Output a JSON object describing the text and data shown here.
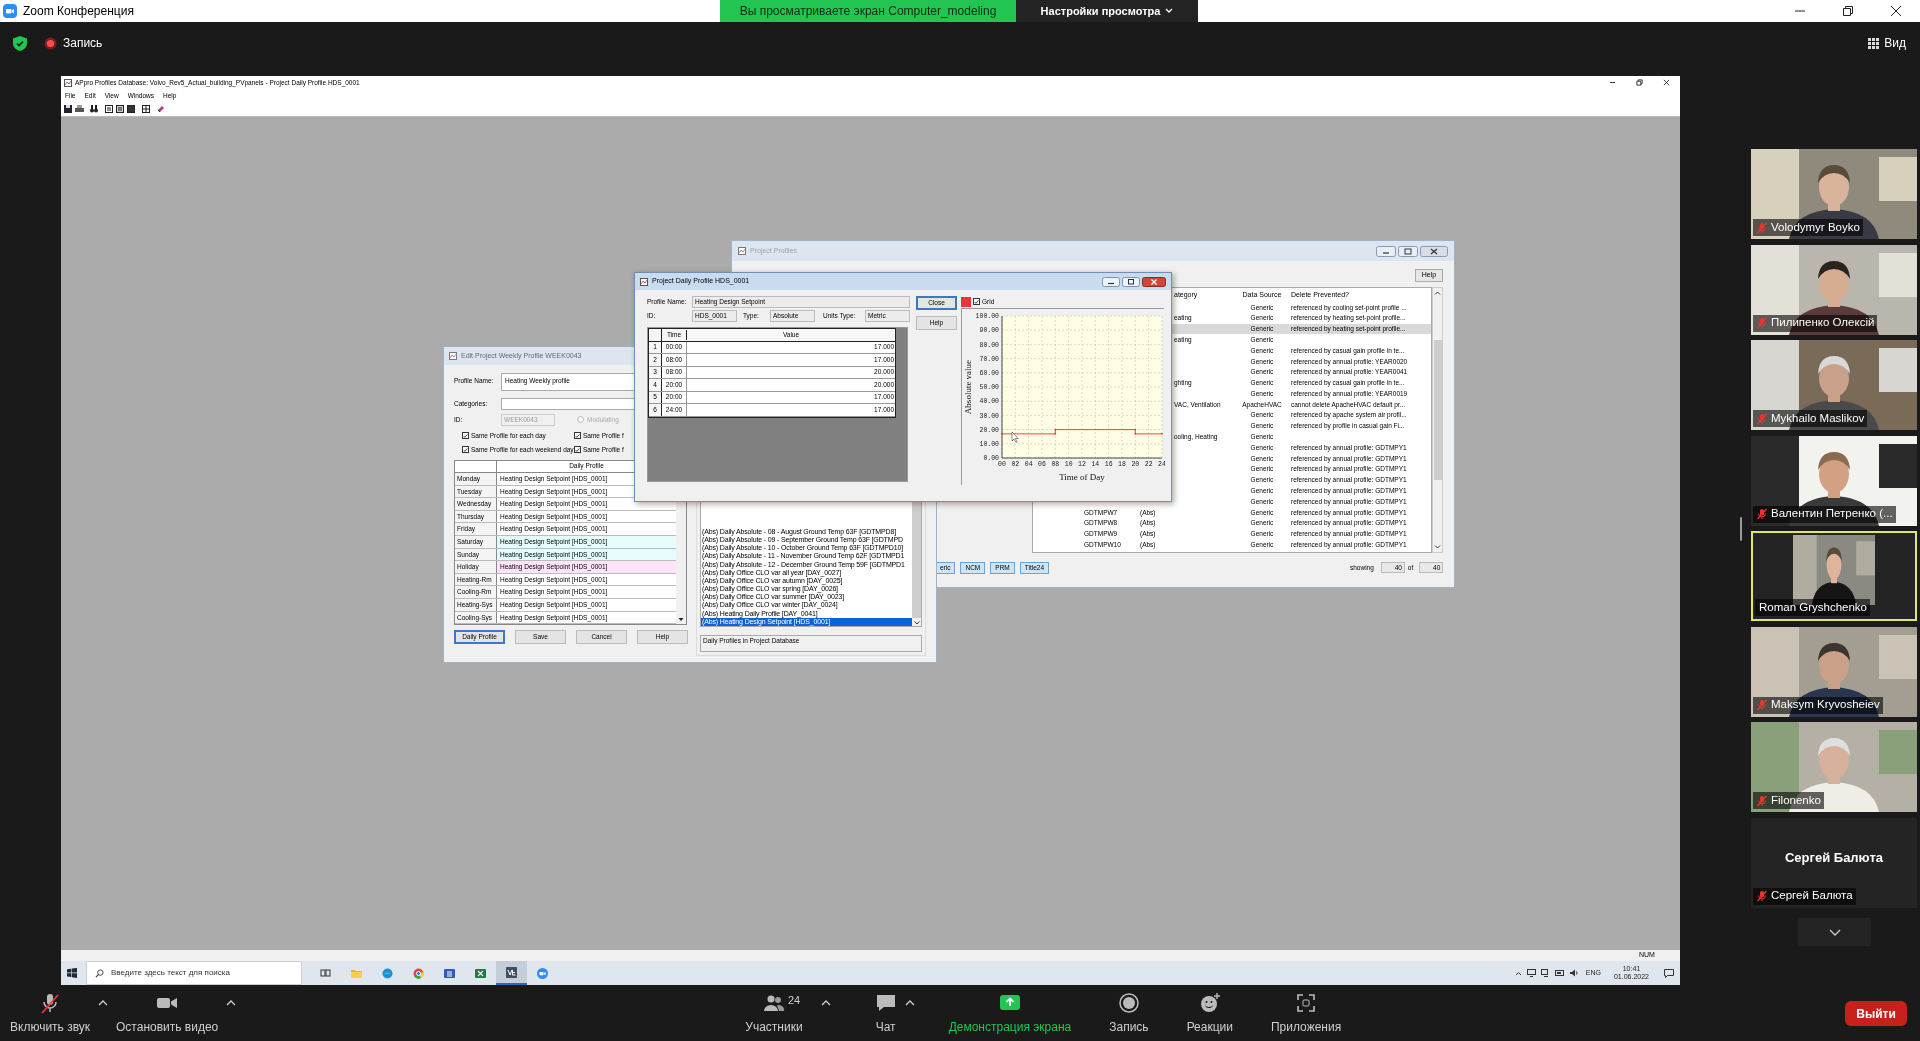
{
  "zoom": {
    "window_title": "Zoom Конференция",
    "banner": "Вы просматриваете экран Computer_modeling",
    "view_options": "Настройки просмотра",
    "recording": "Запись",
    "view": "Вид"
  },
  "app": {
    "title": "APpro Profiles Database: Volvo_Rev5_Actual_building_PVpanels - Project Daily Profile HDS_0001",
    "menu": [
      "File",
      "Edit",
      "View",
      "Windows",
      "Help"
    ],
    "status": "NUM"
  },
  "project_profiles": {
    "title": "Project Profiles",
    "help": "Help",
    "columns": [
      "ategory",
      "Data Source",
      "Delete Prevented?"
    ],
    "rows": [
      {
        "source": "Generic",
        "note": "referenced by cooling set-point profile ...",
        "selected": false
      },
      {
        "category": "eating",
        "source": "Generic",
        "note": "referenced by heating set-point profile...",
        "selected": false
      },
      {
        "source": "Generic",
        "note": "referenced by heating set-point profile...",
        "selected": true
      },
      {
        "category": "eating",
        "source": "Generic",
        "selected": false
      },
      {
        "source": "Generic",
        "note": "referenced by casual gain profile in te...",
        "selected": false
      },
      {
        "source": "Generic",
        "note": "referenced by annual profile: YEAR0020",
        "selected": false
      },
      {
        "source": "Generic",
        "note": "referenced by annual profile: YEAR0041",
        "selected": false
      },
      {
        "category": "ghting",
        "source": "Generic",
        "note": "referenced by casual gain profile in te...",
        "selected": false
      },
      {
        "source": "Generic",
        "note": "referenced by annual profile: YEAR0019",
        "selected": false
      },
      {
        "category": "VAC, Ventilation",
        "source": "ApacheHVAC",
        "note": "cannot delete ApacheHVAC default pr...",
        "selected": false
      },
      {
        "source": "Generic",
        "note": "referenced by apache system air profil...",
        "selected": false
      },
      {
        "source": "Generic",
        "note": "referenced by profile in casual gain  Fi...",
        "selected": false
      },
      {
        "category": "ooling, Heating",
        "source": "Generic",
        "selected": false
      },
      {
        "source": "Generic",
        "note": "referenced by annual profile: GDTMPY1",
        "selected": false
      },
      {
        "source": "Generic",
        "note": "referenced by annual profile: GDTMPY1",
        "selected": false
      },
      {
        "source": "Generic",
        "note": "referenced by annual profile: GDTMPY1",
        "selected": false
      },
      {
        "source": "Generic",
        "note": "referenced by annual profile: GDTMPY1",
        "selected": false
      },
      {
        "source": "Generic",
        "note": "referenced by annual profile: GDTMPY1",
        "selected": false
      },
      {
        "source": "Generic",
        "note": "referenced by annual profile: GDTMPY1",
        "selected": false
      },
      {
        "id": "GDTMPW7",
        "type": "(Abs)",
        "source": "Generic",
        "note": "referenced by annual profile: GDTMPY1",
        "selected": false
      },
      {
        "id": "GDTMPW8",
        "type": "(Abs)",
        "source": "Generic",
        "note": "referenced by annual profile: GDTMPY1",
        "selected": false
      },
      {
        "id": "GDTMPW9",
        "type": "(Abs)",
        "source": "Generic",
        "note": "referenced by annual profile: GDTMPY1",
        "selected": false
      },
      {
        "id": "GDTMPW10",
        "type": "(Abs)",
        "source": "Generic",
        "note": "referenced by annual profile: GDTMPY1",
        "selected": false
      }
    ],
    "tabs": [
      "eric",
      "NCM",
      "PRM",
      "Title24"
    ],
    "showing_label": "showing",
    "showing": "40",
    "of_label": "of",
    "total": "40"
  },
  "weekly": {
    "title": "Edit Project Weekly Profile WEEK0043",
    "profile_name_label": "Profile Name:",
    "profile_name": "Heating Weekly profile",
    "categories_label": "Categories:",
    "id_label": "ID:",
    "id": "WEEK0043",
    "modulating": {
      "label": "Modulating",
      "selected": false
    },
    "checkboxes": [
      {
        "label": "Same Profile for each day",
        "checked": true
      },
      {
        "label": "Same Profile f",
        "checked": true
      },
      {
        "label": "Same Profile for each weekend day",
        "checked": true
      },
      {
        "label": "Same Profile f",
        "checked": true
      }
    ],
    "column": "Daily Profile",
    "days": [
      {
        "day": "Monday",
        "profile": "Heating Design Setpoint [HDS_0001]",
        "color": "#ffffff"
      },
      {
        "day": "Tuesday",
        "profile": "Heating Design Setpoint [HDS_0001]",
        "color": "#ffffff"
      },
      {
        "day": "Wednesday",
        "profile": "Heating Design Setpoint [HDS_0001]",
        "color": "#ffffff"
      },
      {
        "day": "Thursday",
        "profile": "Heating Design Setpoint [HDS_0001]",
        "color": "#ffffff"
      },
      {
        "day": "Friday",
        "profile": "Heating Design Setpoint [HDS_0001]",
        "color": "#ffffff"
      },
      {
        "day": "Saturday",
        "profile": "Heating Design Setpoint [HDS_0001]",
        "color": "#e4fcfc"
      },
      {
        "day": "Sunday",
        "profile": "Heating Design Setpoint [HDS_0001]",
        "color": "#e4fcfc"
      },
      {
        "day": "Holiday",
        "profile": "Heating Design Setpoint [HDS_0001]",
        "color": "#fde4f8"
      },
      {
        "day": "Heating-Rm",
        "profile": "Heating Design Setpoint [HDS_0001]",
        "color": "#ffffff"
      },
      {
        "day": "Cooling-Rm",
        "profile": "Heating Design Setpoint [HDS_0001]",
        "color": "#ffffff"
      },
      {
        "day": "Heating-Sys",
        "profile": "Heating Design Setpoint [HDS_0001]",
        "color": "#ffffff"
      },
      {
        "day": "Cooling-Sys",
        "profile": "Heating Design Setpoint [HDS_0001]",
        "color": "#ffffff"
      }
    ],
    "buttons": [
      {
        "label": "Daily Profile",
        "focused": true
      },
      {
        "label": "Save",
        "focused": false
      },
      {
        "label": "Cancel",
        "focused": false
      },
      {
        "label": "Help",
        "focused": false
      }
    ],
    "list": [
      {
        "label": "(Abs) Daily Absolute - 08 - August Ground Temp 63F [GDTMPD8]",
        "selected": false
      },
      {
        "label": "(Abs) Daily Absolute - 09 - September Ground Temp 63F [GDTMPD",
        "selected": false
      },
      {
        "label": "(Abs) Daily Absolute - 10 - October Ground Temp 63F [GDTMPD10]",
        "selected": false
      },
      {
        "label": "(Abs) Daily Absolute - 11 - November Ground Temp 62F [GDTMPD1",
        "selected": false
      },
      {
        "label": "(Abs) Daily Absolute - 12 - December Ground Temp 59F [GDTMPD1",
        "selected": false
      },
      {
        "label": "(Abs) Daily Office CLO var all year [DAY_0027]",
        "selected": false
      },
      {
        "label": "(Abs) Daily Office CLO var autumn [DAY_0025]",
        "selected": false
      },
      {
        "label": "(Abs) Daily Office CLO var spring [DAY_0026]",
        "selected": false
      },
      {
        "label": "(Abs) Daily Office CLO var summer [DAY_0023]",
        "selected": false
      },
      {
        "label": "(Abs) Daily Office CLO var winter [DAY_0024]",
        "selected": false
      },
      {
        "label": "(Abs) Heating Daily Profile [DAY_0041]",
        "selected": false
      },
      {
        "label": "(Abs) Heating Design Setpoint [HDS_0001]",
        "selected": true
      }
    ],
    "list_caption": "Daily Profiles in Project Database"
  },
  "daily": {
    "title": "Project Daily Profile HDS_0001",
    "profile_name_label": "Profile Name:",
    "profile_name": "Heating Design Setpoint",
    "id_label": "ID:",
    "id": "HDS_0001",
    "type_label": "Type:",
    "type": "Absolute",
    "units_label": "Units Type:",
    "units": "Metric",
    "columns": [
      "Time",
      "Value"
    ],
    "rows": [
      {
        "number": "1",
        "time": "00:00",
        "value": "17.000"
      },
      {
        "number": "2",
        "time": "08:00",
        "value": "17.000"
      },
      {
        "number": "3",
        "time": "08:00",
        "value": "20.000"
      },
      {
        "number": "4",
        "time": "20:00",
        "value": "20.000"
      },
      {
        "number": "5",
        "time": "20:00",
        "value": "17.000"
      },
      {
        "number": "6",
        "time": "24:00",
        "value": "17.000"
      }
    ],
    "close": "Close",
    "help": "Help",
    "grid_label": "Grid",
    "chart_data": {
      "type": "line",
      "grid": true,
      "xlabel": "Time of Day",
      "ylabel": "Absolute value",
      "x": [
        0,
        8,
        8,
        20,
        20,
        24
      ],
      "series": [
        {
          "color": "#ee3333",
          "values": [
            17,
            17,
            20,
            20,
            17,
            17
          ]
        }
      ],
      "xlim": [
        0,
        24
      ],
      "ylim": [
        0,
        100
      ],
      "xticks": [
        {
          "value": 0,
          "label": "00"
        },
        {
          "value": 2,
          "label": "02"
        },
        {
          "value": 4,
          "label": "04"
        },
        {
          "value": 6,
          "label": "06"
        },
        {
          "value": 8,
          "label": "08"
        },
        {
          "value": 10,
          "label": "10"
        },
        {
          "value": 12,
          "label": "12"
        },
        {
          "value": 14,
          "label": "14"
        },
        {
          "value": 16,
          "label": "16"
        },
        {
          "value": 18,
          "label": "18"
        },
        {
          "value": 20,
          "label": "20"
        },
        {
          "value": 22,
          "label": "22"
        },
        {
          "value": 24,
          "label": "24"
        }
      ],
      "yticks": [
        {
          "value": 0,
          "label": "0.00"
        },
        {
          "value": 10,
          "label": "10.00"
        },
        {
          "value": 20,
          "label": "20.00"
        },
        {
          "value": 30,
          "label": "30.00"
        },
        {
          "value": 40,
          "label": "40.00"
        },
        {
          "value": 50,
          "label": "50.00"
        },
        {
          "value": 60,
          "label": "60.00"
        },
        {
          "value": 70,
          "label": "70.00"
        },
        {
          "value": 80,
          "label": "80.00"
        },
        {
          "value": 90,
          "label": "90.00"
        },
        {
          "value": 100,
          "label": "100.00"
        }
      ]
    }
  },
  "taskbar": {
    "search_placeholder": "Введите здесь текст для поиска",
    "apps": [
      {
        "kind": "task-view",
        "selected": false
      },
      {
        "kind": "folder",
        "selected": false
      },
      {
        "kind": "edge",
        "selected": false
      },
      {
        "kind": "chrome",
        "selected": false
      },
      {
        "kind": "word",
        "selected": false
      },
      {
        "kind": "excel",
        "selected": false
      },
      {
        "kind": "ve",
        "selected": true
      },
      {
        "kind": "zoom",
        "selected": false
      }
    ],
    "language": "ENG",
    "time": "10:41",
    "date": "01.06.2022"
  },
  "participants": [
    {
      "name": "Volodymyr Boyko",
      "muted": true,
      "speaking": false,
      "video": true
    },
    {
      "name": "Пилипенко Олексій",
      "muted": true,
      "speaking": false,
      "video": true
    },
    {
      "name": "Mykhailo Maslikov",
      "muted": true,
      "speaking": false,
      "video": true
    },
    {
      "name": "Валентин Петренко (...",
      "muted": true,
      "speaking": false,
      "video": true
    },
    {
      "name": "Roman Gryshchenko",
      "muted": false,
      "speaking": true,
      "video": true
    },
    {
      "name": "Maksym Kryvosheiev",
      "muted": true,
      "speaking": false,
      "video": true
    },
    {
      "name": "Filonenko",
      "muted": true,
      "speaking": false,
      "video": true
    },
    {
      "name": "Сергей Балюта",
      "display_name": "Сергей Балюта",
      "muted": true,
      "speaking": false,
      "video": false
    }
  ],
  "toolbar": [
    {
      "kind": "mic",
      "label": "Включить звук",
      "menu": true
    },
    {
      "kind": "video",
      "label": "Остановить видео",
      "menu": true
    },
    {
      "kind": "participants",
      "label": "Участники",
      "count": "24",
      "menu": true
    },
    {
      "kind": "chat",
      "label": "Чат",
      "menu": true
    },
    {
      "kind": "share",
      "label": "Демонстрация экрана",
      "menu": false
    },
    {
      "kind": "record",
      "label": "Запись",
      "menu": false
    },
    {
      "kind": "reactions",
      "label": "Реакции",
      "menu": false
    },
    {
      "kind": "apps",
      "label": "Приложения",
      "menu": false
    }
  ],
  "leave": "Выйти"
}
